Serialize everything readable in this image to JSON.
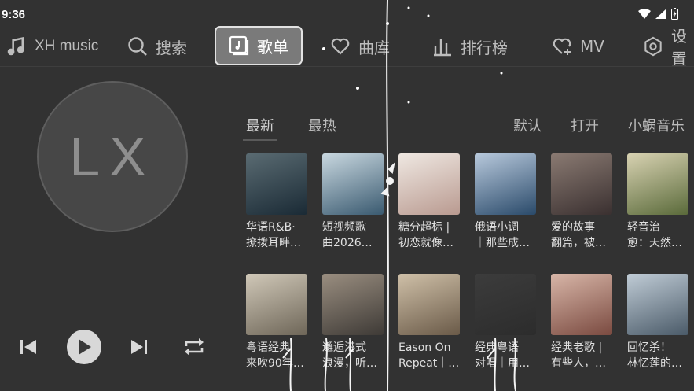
{
  "status": {
    "time": "9:36"
  },
  "nav": {
    "brand": "XH music",
    "items": [
      {
        "label": "搜索"
      },
      {
        "label": "歌单"
      },
      {
        "label": "曲库"
      },
      {
        "label": "排行榜"
      },
      {
        "label": "MV"
      },
      {
        "label": "设置"
      }
    ]
  },
  "profile": {
    "initials": "LX"
  },
  "tabs": {
    "left": [
      {
        "label": "最新"
      },
      {
        "label": "最热"
      }
    ],
    "right": [
      {
        "label": "默认"
      },
      {
        "label": "打开"
      },
      {
        "label": "小蜗音乐"
      }
    ]
  },
  "playlists": [
    {
      "l1": "华语R&B·",
      "l2": "撩拨耳畔…",
      "c1": "#1a2a35",
      "c2": "#5a6b72"
    },
    {
      "l1": "短视频歌",
      "l2": "曲2026…",
      "c1": "#3a5a70",
      "c2": "#c9d8e0"
    },
    {
      "l1": "糖分超标 |",
      "l2": "初恋就像…",
      "c1": "#b99a90",
      "c2": "#efe8e2"
    },
    {
      "l1": "俄语小调",
      "l2": "｜那些成…",
      "c1": "#2a4a6a",
      "c2": "#b8c9dc"
    },
    {
      "l1": "爱的故事",
      "l2": "翻篇，被…",
      "c1": "#3a3030",
      "c2": "#8a7a72"
    },
    {
      "l1": "轻音治",
      "l2": "愈：天然…",
      "c1": "#5a6a3a",
      "c2": "#d8d2b2"
    },
    {
      "l1": "粤语经典",
      "l2": "来吹90年…",
      "c1": "#6e6658",
      "c2": "#d0c8b8"
    },
    {
      "l1": "邂逅港式",
      "l2": "浪漫，听…",
      "c1": "#3e3a36",
      "c2": "#9a8e80"
    },
    {
      "l1": "Eason On",
      "l2": "Repeat｜…",
      "c1": "#6a5a48",
      "c2": "#cfc0a8"
    },
    {
      "l1": "经典粤语",
      "l2": "对唱｜用…",
      "c1": "#2c2c2c",
      "c2": "#3c3c3c"
    },
    {
      "l1": "经典老歌 |",
      "l2": "有些人，…",
      "c1": "#7a4a40",
      "c2": "#d8b6a8"
    },
    {
      "l1": "回忆杀！",
      "l2": "林忆莲的…",
      "c1": "#4a5a68",
      "c2": "#c0ccd6"
    }
  ],
  "colors": {
    "background": "#323232",
    "active_tab_bg": "#7a7a7a",
    "text": "#e0e0e0"
  }
}
